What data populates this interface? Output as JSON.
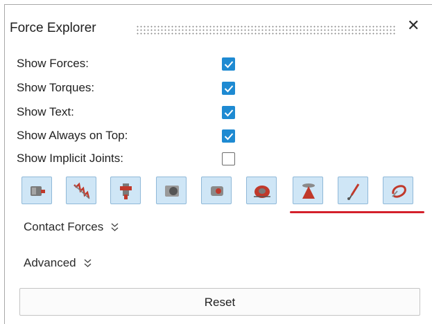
{
  "panel": {
    "title": "Force Explorer",
    "close_label": "✕"
  },
  "options": [
    {
      "label": "Show Forces:",
      "checked": true
    },
    {
      "label": "Show Torques:",
      "checked": true
    },
    {
      "label": "Show Text:",
      "checked": true
    },
    {
      "label": "Show Always on Top:",
      "checked": true
    },
    {
      "label": "Show Implicit Joints:",
      "checked": false
    }
  ],
  "toolbar": {
    "icons": [
      "motor-icon",
      "spring-icon",
      "joint-icon",
      "ball-joint-icon",
      "actuator-icon",
      "contact-icon",
      "cone-force-icon",
      "pen-force-icon",
      "ring-force-icon"
    ],
    "accent_color": "#d4202b",
    "button_color": "#cfe6f6"
  },
  "sections": {
    "contact_forces": "Contact Forces",
    "advanced": "Advanced"
  },
  "reset_label": "Reset"
}
